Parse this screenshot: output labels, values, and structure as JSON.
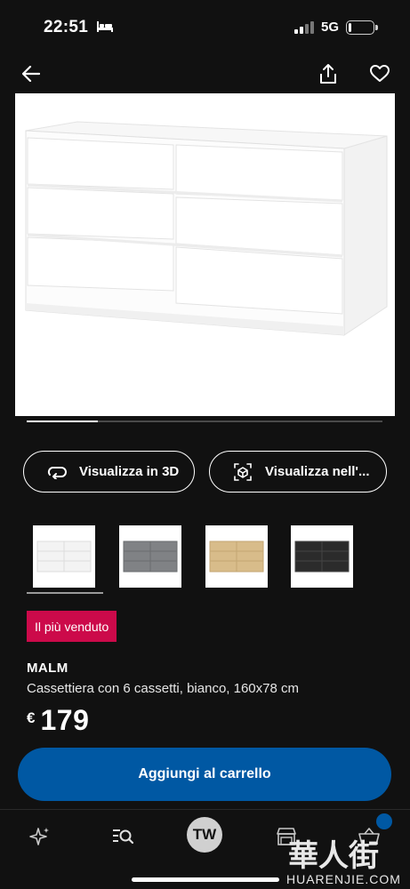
{
  "status_bar": {
    "time": "22:51",
    "network": "5G",
    "battery_level": 0.12
  },
  "nav": {
    "back_icon": "arrow-left-icon",
    "share_icon": "share-icon",
    "favorite_icon": "heart-icon"
  },
  "gallery": {
    "image": "white 6-drawer dresser",
    "position_fraction": 0.2
  },
  "actions": {
    "view_3d_label": "Visualizza in 3D",
    "view_in_room_label": "Visualizza nell'..."
  },
  "color_swatches": [
    {
      "name": "bianco",
      "color": "#f3f3f3",
      "selected": true
    },
    {
      "name": "grigio",
      "color": "#808285",
      "selected": false
    },
    {
      "name": "rovere",
      "color": "#d8bc8a",
      "selected": false
    },
    {
      "name": "nero",
      "color": "#2b2b2b",
      "selected": false
    }
  ],
  "product": {
    "badge": "Il più venduto",
    "name": "MALM",
    "description": "Cassettiera con 6 cassetti, bianco, 160x78 cm",
    "currency": "€",
    "price": "179",
    "add_to_cart_label": "Aggiungi al carrello"
  },
  "tab_bar": {
    "items": [
      "sparkle-icon",
      "search-list-icon",
      "profile-avatar",
      "store-icon",
      "basket-icon"
    ],
    "avatar_initials": "TW",
    "cart_badge_color": "#0058a3"
  },
  "colors": {
    "background": "#111111",
    "accent_blue": "#0058a3",
    "badge_red": "#cc0a4a"
  },
  "watermark": {
    "text_cn": "華人街",
    "text_latin": "HUARENJIE.COM"
  }
}
